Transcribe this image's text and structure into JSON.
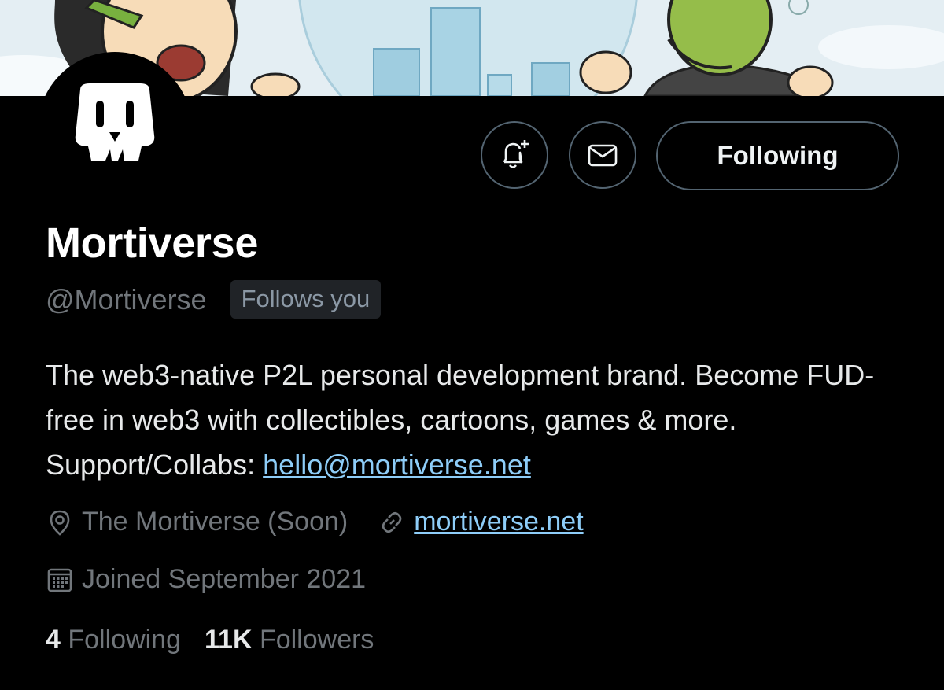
{
  "profile": {
    "name": "Mortiverse",
    "handle": "@Mortiverse",
    "follows_you": "Follows you",
    "bio_text": "The web3-native P2L personal development brand. Become FUD-free in web3 with collectibles, cartoons, games & more. Support/Collabs: ",
    "bio_email": "hello@mortiverse.net",
    "location": "The Mortiverse (Soon)",
    "website": "mortiverse.net",
    "joined": "Joined September 2021"
  },
  "actions": {
    "following_label": "Following"
  },
  "stats": {
    "following_count": "4",
    "following_label": "Following",
    "followers_count": "11K",
    "followers_label": "Followers"
  },
  "icons": {
    "notify": "bell-plus-icon",
    "message": "envelope-icon",
    "location": "location-pin-icon",
    "website": "link-icon",
    "joined": "calendar-icon"
  },
  "colors": {
    "background": "#000000",
    "link": "#8ecdf8",
    "muted": "#71767b",
    "border": "#536471"
  }
}
